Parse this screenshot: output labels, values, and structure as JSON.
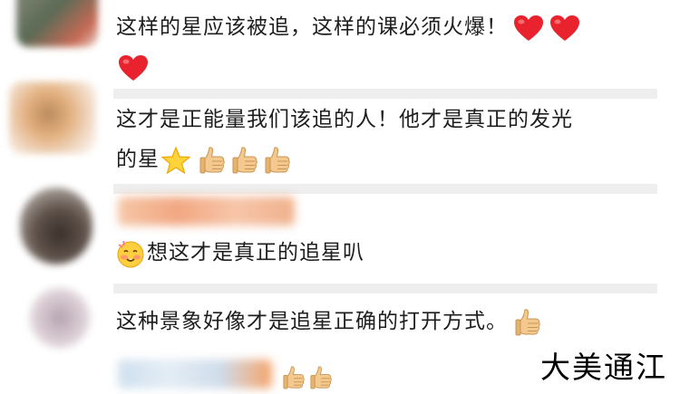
{
  "comments": [
    {
      "text_line1": "这样的星应该被追，这样的课必须火爆！",
      "emojis": [
        "heart",
        "heart",
        "heart"
      ]
    },
    {
      "text_line1": "这才是正能量我们该追的人！他才是真正的发光",
      "text_line2_prefix": "的星",
      "emojis": [
        "star",
        "thumbs-up",
        "thumbs-up",
        "thumbs-up"
      ]
    },
    {
      "text_line1": "想这才是真正的追星叭",
      "emojis": [
        "blushing-face"
      ]
    },
    {
      "text_line1": "这种景象好像才是追星正确的打开方式。",
      "emojis": [
        "thumbs-up"
      ]
    },
    {
      "emojis": [
        "thumbs-up",
        "thumbs-up"
      ]
    }
  ],
  "watermark": "大美通江",
  "colors": {
    "heart": "#e8232e",
    "separator": "#eeeeee",
    "text": "#1e1e1e"
  }
}
